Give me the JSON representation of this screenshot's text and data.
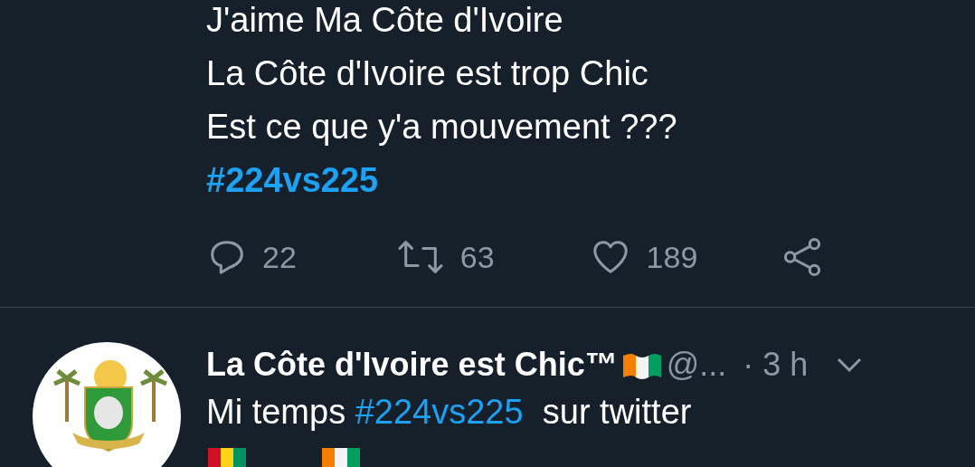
{
  "tweet": {
    "lines": [
      {
        "kind": "text",
        "text": "J'aime Ma Côte d'Ivoire"
      },
      {
        "kind": "text",
        "text": "La Côte d'Ivoire est trop Chic"
      },
      {
        "kind": "text",
        "text": "Est ce que y'a mouvement ???"
      },
      {
        "kind": "hashtag",
        "text": "#224vs225"
      }
    ],
    "actions": [
      {
        "kind": "reply",
        "count": "22"
      },
      {
        "kind": "retweet",
        "count": "63"
      },
      {
        "kind": "like",
        "count": "189"
      },
      {
        "kind": "share"
      }
    ]
  },
  "next_tweet": {
    "name": "La Côte d'Ivoire est Chic™",
    "handle": "@...",
    "time": "· 3 h",
    "segments": [
      {
        "kind": "text",
        "text": "Mi temps "
      },
      {
        "kind": "hashtag",
        "text": "#224vs225"
      },
      {
        "kind": "text",
        "text": "  sur twitter"
      }
    ]
  }
}
